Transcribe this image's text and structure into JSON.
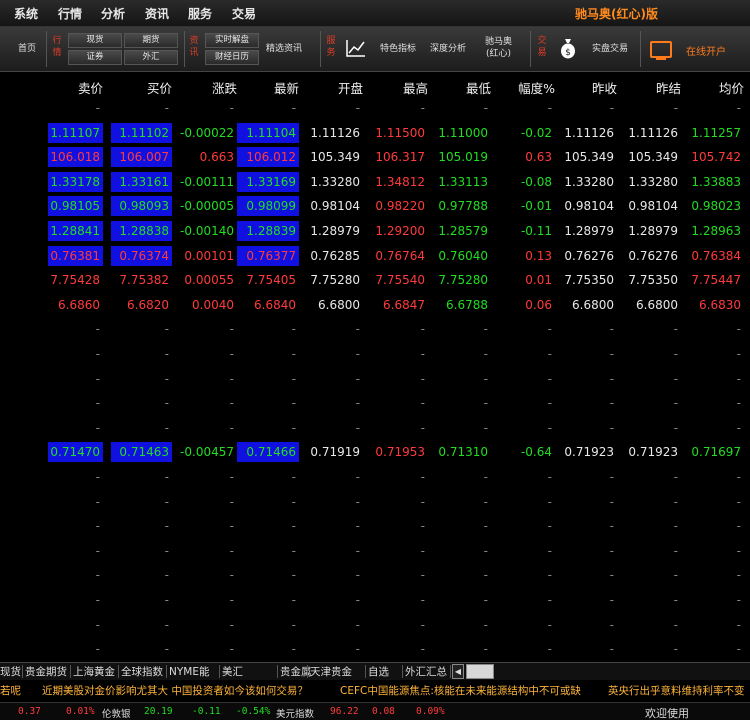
{
  "menu": {
    "items": [
      "系统",
      "行情",
      "分析",
      "资讯",
      "服务",
      "交易"
    ],
    "brand": "驰马奥(红心)版"
  },
  "toolbar": {
    "home": "首页",
    "group_quotes": "行情",
    "spot": "现货",
    "futures": "期货",
    "securities": "证券",
    "forex": "外汇",
    "group_news": "资讯",
    "realtime": "实时解盘",
    "calendar": "财经日历",
    "selected_news": "精选资讯",
    "group_service": "服务",
    "indicators": "特色指标",
    "deep_analysis": "深度分析",
    "brand_line1": "驰马奥",
    "brand_line2": "(红心)",
    "group_trade": "交易",
    "live_trade": "实盘交易",
    "open_account": "在线开户"
  },
  "table": {
    "headers": [
      "卖价",
      "买价",
      "涨跌",
      "最新",
      "开盘",
      "最高",
      "最低",
      "幅度%",
      "昨收",
      "昨结",
      "均价"
    ],
    "rows": [
      {
        "cells": [
          "-",
          "-",
          "-",
          "-",
          "-",
          "-",
          "-",
          "-",
          "-",
          "-",
          "-"
        ],
        "empty": true
      },
      {
        "cells": [
          "1.11107",
          "1.11102",
          "-0.00022",
          "1.11104",
          "1.11126",
          "1.11500",
          "1.11000",
          "-0.02",
          "1.11126",
          "1.11126",
          "1.11257"
        ],
        "dir": "down",
        "hl": true
      },
      {
        "cells": [
          "106.018",
          "106.007",
          "0.663",
          "106.012",
          "105.349",
          "106.317",
          "105.019",
          "0.63",
          "105.349",
          "105.349",
          "105.742"
        ],
        "dir": "up",
        "hl": true
      },
      {
        "cells": [
          "1.33178",
          "1.33161",
          "-0.00111",
          "1.33169",
          "1.33280",
          "1.34812",
          "1.33113",
          "-0.08",
          "1.33280",
          "1.33280",
          "1.33883"
        ],
        "dir": "down",
        "hl": true
      },
      {
        "cells": [
          "0.98105",
          "0.98093",
          "-0.00005",
          "0.98099",
          "0.98104",
          "0.98220",
          "0.97788",
          "-0.01",
          "0.98104",
          "0.98104",
          "0.98023"
        ],
        "dir": "down",
        "hl": true
      },
      {
        "cells": [
          "1.28841",
          "1.28838",
          "-0.00140",
          "1.28839",
          "1.28979",
          "1.29200",
          "1.28579",
          "-0.11",
          "1.28979",
          "1.28979",
          "1.28963"
        ],
        "dir": "down",
        "hl": true
      },
      {
        "cells": [
          "0.76381",
          "0.76374",
          "0.00101",
          "0.76377",
          "0.76285",
          "0.76764",
          "0.76040",
          "0.13",
          "0.76276",
          "0.76276",
          "0.76384"
        ],
        "dir": "up",
        "hl": true
      },
      {
        "cells": [
          "7.75428",
          "7.75382",
          "0.00055",
          "7.75405",
          "7.75280",
          "7.75540",
          "7.75280",
          "0.01",
          "7.75350",
          "7.75350",
          "7.75447"
        ],
        "dir": "up",
        "hl": false
      },
      {
        "cells": [
          "6.6860",
          "6.6820",
          "0.0040",
          "6.6840",
          "6.6800",
          "6.6847",
          "6.6788",
          "0.06",
          "6.6800",
          "6.6800",
          "6.6830"
        ],
        "dir": "up",
        "hl": false
      },
      {
        "cells": [
          "-",
          "-",
          "-",
          "-",
          "-",
          "-",
          "-",
          "-",
          "-",
          "-",
          "-"
        ],
        "empty": true
      },
      {
        "cells": [
          "-",
          "-",
          "-",
          "-",
          "-",
          "-",
          "-",
          "-",
          "-",
          "-",
          "-"
        ],
        "empty": true
      },
      {
        "cells": [
          "-",
          "-",
          "-",
          "-",
          "-",
          "-",
          "-",
          "-",
          "-",
          "-",
          "-"
        ],
        "empty": true
      },
      {
        "cells": [
          "-",
          "-",
          "-",
          "-",
          "-",
          "-",
          "-",
          "-",
          "-",
          "-",
          "-"
        ],
        "empty": true
      },
      {
        "cells": [
          "-",
          "-",
          "-",
          "-",
          "-",
          "-",
          "-",
          "-",
          "-",
          "-",
          "-"
        ],
        "empty": true
      },
      {
        "cells": [
          "0.71470",
          "0.71463",
          "-0.00457",
          "0.71466",
          "0.71919",
          "0.71953",
          "0.71310",
          "-0.64",
          "0.71923",
          "0.71923",
          "0.71697"
        ],
        "dir": "down",
        "hl": true
      },
      {
        "cells": [
          "-",
          "-",
          "-",
          "-",
          "-",
          "-",
          "-",
          "-",
          "-",
          "-",
          "-"
        ],
        "empty": true
      },
      {
        "cells": [
          "-",
          "-",
          "-",
          "-",
          "-",
          "-",
          "-",
          "-",
          "-",
          "-",
          "-"
        ],
        "empty": true
      },
      {
        "cells": [
          "-",
          "-",
          "-",
          "-",
          "-",
          "-",
          "-",
          "-",
          "-",
          "-",
          "-"
        ],
        "empty": true
      },
      {
        "cells": [
          "-",
          "-",
          "-",
          "-",
          "-",
          "-",
          "-",
          "-",
          "-",
          "-",
          "-"
        ],
        "empty": true
      },
      {
        "cells": [
          "-",
          "-",
          "-",
          "-",
          "-",
          "-",
          "-",
          "-",
          "-",
          "-",
          "-"
        ],
        "empty": true
      },
      {
        "cells": [
          "-",
          "-",
          "-",
          "-",
          "-",
          "-",
          "-",
          "-",
          "-",
          "-",
          "-"
        ],
        "empty": true
      },
      {
        "cells": [
          "-",
          "-",
          "-",
          "-",
          "-",
          "-",
          "-",
          "-",
          "-",
          "-",
          "-"
        ],
        "empty": true
      },
      {
        "cells": [
          "-",
          "-",
          "-",
          "-",
          "-",
          "-",
          "-",
          "-",
          "-",
          "-",
          "-"
        ],
        "empty": true
      }
    ]
  },
  "tabs": [
    "现货",
    "贵金期货",
    "上海黄金",
    "全球指数",
    "NYME能",
    "美汇",
    "贵金属",
    "天津贵金",
    "自选",
    "外汇汇总"
  ],
  "ticker": [
    "若呢",
    "近期美股对金价影响尤其大 中国投资者如今该如何交易？",
    "CEFC中国能源焦点:核能在未来能源结构中不可或缺",
    "英央行出乎意料维持利率不变"
  ],
  "status": {
    "v1": "0.37",
    "v2": "0.01%",
    "name1": "伦敦银",
    "v3": "20.19",
    "v4": "-0.11",
    "v5": "-0.54%",
    "name2": "美元指数",
    "v6": "96.22",
    "v7": "0.08",
    "v8": "0.09%",
    "welcome": "欢迎使用"
  },
  "colors": {
    "up": "#ff3b3b",
    "down": "#22dd22",
    "highlight": "#1010e0",
    "brand": "#ff7a1a"
  }
}
